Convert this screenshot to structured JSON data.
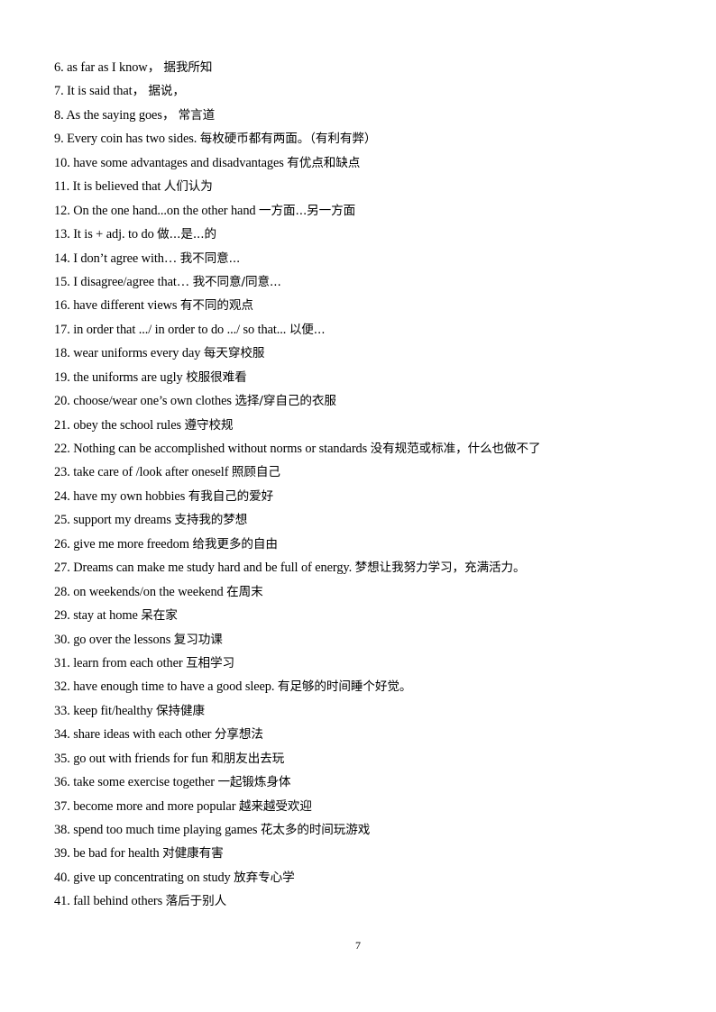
{
  "document": {
    "page_number": "7",
    "background_color": "#ffffff",
    "text_color": "#000000",
    "lines": [
      {
        "index": "6.",
        "english": "as far as I know，",
        "chinese": "据我所知"
      },
      {
        "index": "7.",
        "english": "It is said that，",
        "chinese": "据说，"
      },
      {
        "index": "8.",
        "english": "As the saying goes，",
        "chinese": "常言道"
      },
      {
        "index": "9.",
        "english": "Every coin has two sides.",
        "chinese": "每枚硬币都有两面。（有利有弊）"
      },
      {
        "index": "10.",
        "english": "have some advantages and disadvantages",
        "chinese": "有优点和缺点"
      },
      {
        "index": "11.",
        "english": "It is believed that",
        "chinese": "人们认为"
      },
      {
        "index": "12.",
        "english": "On the one hand...on the other hand",
        "chinese": "一方面...另一方面"
      },
      {
        "index": "13.",
        "english": "It is + adj. to do",
        "chinese": "做...是...的"
      },
      {
        "index": "14.",
        "english": "I don’t agree with…",
        "chinese": "我不同意..."
      },
      {
        "index": "15.",
        "english": "I disagree/agree that…",
        "chinese": "我不同意/同意..."
      },
      {
        "index": "16.",
        "english": "have different views",
        "chinese": "有不同的观点"
      },
      {
        "index": "17.",
        "english": "in order that .../ in order to do .../ so that...",
        "chinese": "以便..."
      },
      {
        "index": "18.",
        "english": "wear uniforms every day",
        "chinese": "每天穿校服"
      },
      {
        "index": "19.",
        "english": "the uniforms are ugly",
        "chinese": "校服很难看"
      },
      {
        "index": "20.",
        "english": "choose/wear one’s own clothes",
        "chinese": "选择/穿自己的衣服"
      },
      {
        "index": "21.",
        "english": "obey the school rules",
        "chinese": "遵守校规"
      },
      {
        "index": "22.",
        "english": "Nothing can be accomplished without norms or standards",
        "chinese": "没有规范或标准，什么也做不了"
      },
      {
        "index": "23.",
        "english": "take care of /look after oneself",
        "chinese": "照顾自己"
      },
      {
        "index": "24.",
        "english": "have my own hobbies",
        "chinese": "有我自己的爱好"
      },
      {
        "index": "25.",
        "english": "support my dreams",
        "chinese": "支持我的梦想"
      },
      {
        "index": "26.",
        "english": "give me more freedom",
        "chinese": "给我更多的自由"
      },
      {
        "index": "27.",
        "english": "Dreams can make me study hard and be full of energy.",
        "chinese": "梦想让我努力学习，充满活力。"
      },
      {
        "index": "28.",
        "english": "on weekends/on the weekend",
        "chinese": "在周末"
      },
      {
        "index": "29.",
        "english": "stay at home",
        "chinese": "呆在家"
      },
      {
        "index": "30.",
        "english": "go over the lessons",
        "chinese": "复习功课"
      },
      {
        "index": "31.",
        "english": "learn from each other",
        "chinese": "互相学习"
      },
      {
        "index": "32.",
        "english": "have enough time to have a good sleep.",
        "chinese": "有足够的时间睡个好觉。"
      },
      {
        "index": "33.",
        "english": "keep fit/healthy",
        "chinese": "保持健康"
      },
      {
        "index": "34.",
        "english": "share ideas with each other",
        "chinese": "分享想法"
      },
      {
        "index": "35.",
        "english": "go out with friends for fun",
        "chinese": "和朋友出去玩"
      },
      {
        "index": "36.",
        "english": "take some exercise together",
        "chinese": "一起锻炼身体"
      },
      {
        "index": "37.",
        "english": "become more and more popular",
        "chinese": "越来越受欢迎"
      },
      {
        "index": "38.",
        "english": "spend too much time playing games",
        "chinese": "花太多的时间玩游戏"
      },
      {
        "index": "39.",
        "english": "be bad for health",
        "chinese": "对健康有害"
      },
      {
        "index": "40.",
        "english": "give up concentrating on study",
        "chinese": "放弃专心学"
      },
      {
        "index": "41.",
        "english": "fall behind others",
        "chinese": "落后于别人"
      }
    ]
  }
}
